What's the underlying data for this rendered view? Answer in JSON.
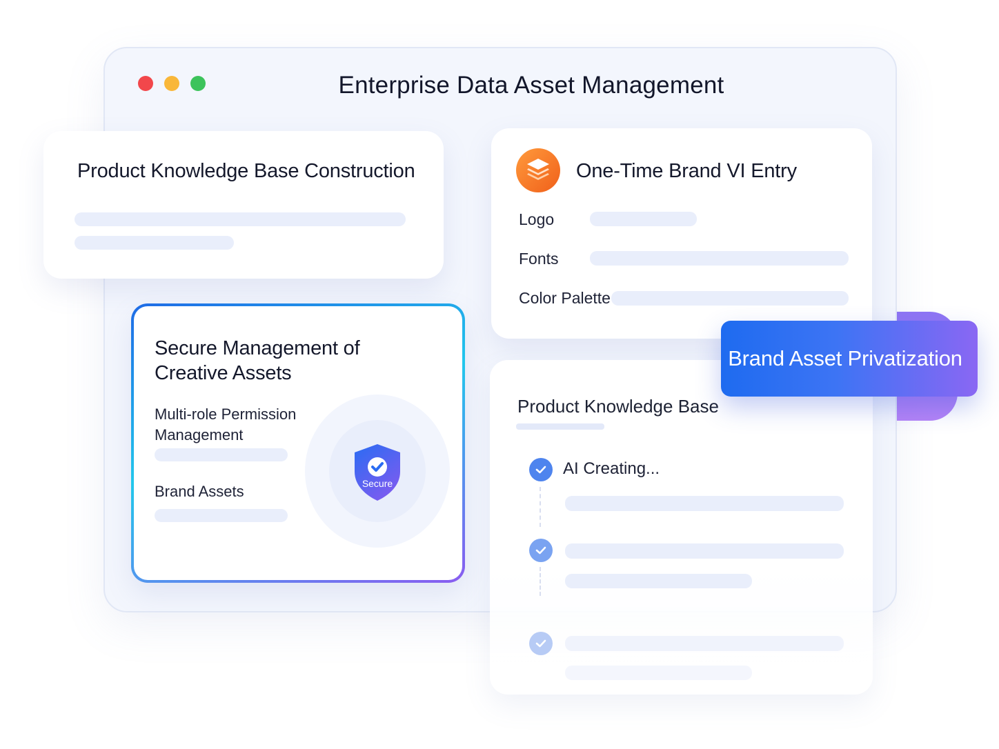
{
  "window": {
    "title": "Enterprise Data Asset Management",
    "controls": [
      {
        "name": "close",
        "color": "#f2474b"
      },
      {
        "name": "minimize",
        "color": "#f9b739"
      },
      {
        "name": "maximize",
        "color": "#3cc35b"
      }
    ]
  },
  "knowledge_base_card": {
    "title": "Product Knowledge Base Construction"
  },
  "vi_card": {
    "icon": "layers-icon",
    "title": "One-Time Brand VI Entry",
    "rows": [
      {
        "label": "Logo"
      },
      {
        "label": "Fonts"
      },
      {
        "label": "Color Palette"
      }
    ]
  },
  "secure_card": {
    "title_line1": "Secure Management of",
    "title_line2": "Creative Assets",
    "permission_line1": "Multi-role Permission",
    "permission_line2": "Management",
    "brand_assets": "Brand Assets",
    "shield_label": "Secure",
    "shield_icon": "shield-check-icon"
  },
  "product_kb_panel": {
    "title": "Product Knowledge Base",
    "steps": [
      {
        "label": "AI Creating...",
        "icon": "check-circle-icon"
      },
      {
        "label": "",
        "icon": "check-circle-icon"
      },
      {
        "label": "",
        "icon": "check-circle-icon"
      }
    ]
  },
  "badge": {
    "label": "Brand Asset Privatization"
  },
  "colors": {
    "accent_blue": "#1e6bf0",
    "accent_purple": "#8a67f3",
    "accent_orange": "#f37a1f",
    "placeholder_bar": "#e9eefb"
  }
}
